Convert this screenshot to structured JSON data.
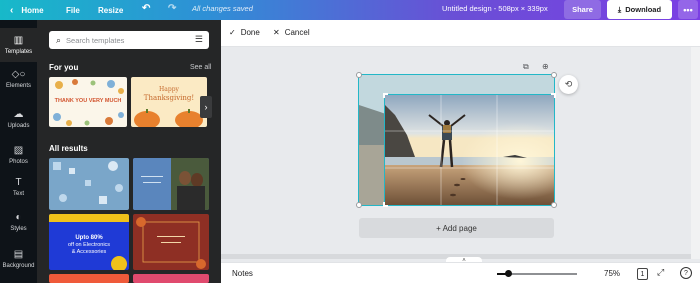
{
  "topbar": {
    "home_label": "Home",
    "file_label": "File",
    "resize_label": "Resize",
    "saved_status": "All changes saved",
    "doc_title": "Untitled design - 508px × 339px",
    "share_label": "Share",
    "download_label": "Download",
    "more_label": "•••"
  },
  "rail": {
    "items": [
      {
        "label": "Templates",
        "icon": "templates-icon"
      },
      {
        "label": "Elements",
        "icon": "elements-icon"
      },
      {
        "label": "Uploads",
        "icon": "uploads-icon"
      },
      {
        "label": "Photos",
        "icon": "photos-icon"
      },
      {
        "label": "Text",
        "icon": "text-icon"
      },
      {
        "label": "Styles",
        "icon": "styles-icon"
      },
      {
        "label": "Background",
        "icon": "background-icon"
      }
    ]
  },
  "panel": {
    "search_placeholder": "Search templates",
    "for_you_title": "For you",
    "see_all_label": "See all",
    "all_results_title": "All results",
    "thumbs": {
      "thanks_text": "THANK YOU VERY MUCH",
      "thanksgiving_text_1": "Happy",
      "thanksgiving_text_2": "Thanksgiving!",
      "sale_text_1": "Upto 80%",
      "sale_text_2": "off on Electronics",
      "sale_text_3": "& Accessories"
    }
  },
  "editbar": {
    "done_label": "Done",
    "cancel_label": "Cancel"
  },
  "canvas": {
    "add_page_label": "+ Add page"
  },
  "bottombar": {
    "notes_label": "Notes",
    "zoom_value": "75%",
    "page_count": "1",
    "help_label": "?"
  },
  "colors": {
    "accent": "#23b7c7",
    "topbar_start": "#17b9c9",
    "topbar_end": "#7b3fe4",
    "panel_bg": "#252627",
    "rail_bg": "#0e1318"
  }
}
